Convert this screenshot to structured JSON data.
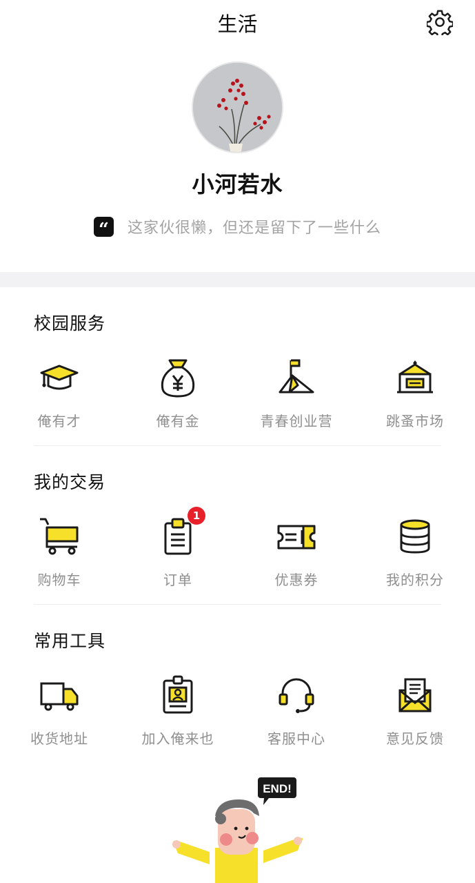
{
  "header": {
    "title": "生活",
    "settings_icon": "gear-icon"
  },
  "profile": {
    "avatar_icon": "avatar-plant-photo",
    "username": "小河若水",
    "quote_mark": "“",
    "signature": "这家伙很懒，但还是留下了一些什么"
  },
  "sections": [
    {
      "title": "校园服务",
      "items": [
        {
          "label": "俺有才",
          "icon": "graduation-cap-icon"
        },
        {
          "label": "俺有金",
          "icon": "money-bag-icon"
        },
        {
          "label": "青春创业营",
          "icon": "tent-icon"
        },
        {
          "label": "跳蚤市场",
          "icon": "market-stall-icon"
        }
      ]
    },
    {
      "title": "我的交易",
      "items": [
        {
          "label": "购物车",
          "icon": "shopping-cart-icon"
        },
        {
          "label": "订单",
          "icon": "clipboard-icon",
          "badge": "1"
        },
        {
          "label": "优惠券",
          "icon": "coupon-ticket-icon"
        },
        {
          "label": "我的积分",
          "icon": "coin-stack-icon"
        }
      ]
    },
    {
      "title": "常用工具",
      "items": [
        {
          "label": "收货地址",
          "icon": "delivery-truck-icon"
        },
        {
          "label": "加入俺来也",
          "icon": "id-badge-icon"
        },
        {
          "label": "客服中心",
          "icon": "headset-icon"
        },
        {
          "label": "意见反馈",
          "icon": "envelope-letter-icon"
        }
      ]
    }
  ],
  "footer": {
    "speech_bubble": "END!"
  },
  "colors": {
    "accent_yellow": "#f7e02a",
    "badge_red": "#e8202a",
    "icon_stroke": "#1a1a1a",
    "label_gray": "#8f8f8f"
  }
}
